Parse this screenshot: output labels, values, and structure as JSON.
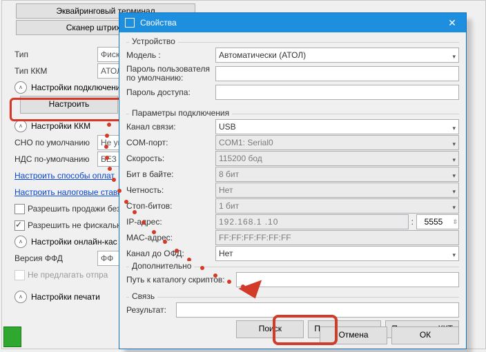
{
  "bg": {
    "top_buttons": [
      "Эквайринговый терминал",
      "Сканер штрих-кодов"
    ],
    "rows": {
      "tip_label": "Тип",
      "tip_value": "Фискал",
      "tipkkm_label": "Тип ККМ",
      "tipkkm_value": "АТОЛ",
      "sect_conn": "Настройки подключения",
      "nastr_btn": "Настроить",
      "sect_kkm": "Настройки ККМ",
      "sno_label": "СНО по умолчанию",
      "sno_value": "Не ук",
      "nds_label": "НДС по-умолчанию",
      "nds_value": "БЕЗ Н",
      "link_pay": "Настроить способы оплат",
      "link_tax": "Настроить налоговые ставки",
      "cb1": "Разрешить продажи без",
      "cb2": "Разрешить не фискальн",
      "sect_online": "Настройки онлайн-кас",
      "ffd_label": "Версия ФФД",
      "ffd_value": "ФФ",
      "cb_greyed": "Не предлагать отпра",
      "sect_print": "Настройки печати"
    }
  },
  "dlg": {
    "title": "Свойства",
    "group_device": "Устройство",
    "model_label": "Модель :",
    "model_value": "Автоматически (АТОЛ)",
    "userpwd_label": "Пароль пользователя по умолчанию:",
    "accesspwd_label": "Пароль доступа:",
    "group_conn": "Параметры подключения",
    "channel_label": "Канал связи:",
    "channel_value": "USB",
    "comport_label": "COM-порт:",
    "comport_value": "COM1: Serial0",
    "speed_label": "Скорость:",
    "speed_value": "115200 бод",
    "bits_label": "Бит в байте:",
    "bits_value": "8 бит",
    "parity_label": "Четность:",
    "parity_value": "Нет",
    "stopbits_label": "Стоп-битов:",
    "stopbits_value": "1 бит",
    "ip_label": "IP-адрес:",
    "ip_value": "192.168.1 .10",
    "port_value": "5555",
    "mac_label": "MAC-адрес:",
    "mac_value": "FF:FF:FF:FF:FF:FF",
    "ofd_label": "Канал до ОФД:",
    "ofd_value": "Нет",
    "group_extra": "Дополнительно",
    "scriptpath_label": "Путь к каталогу скриптов:",
    "group_link": "Связь",
    "result_label": "Результат:",
    "btn_search": "Поиск",
    "btn_check": "Проверка связи",
    "btn_params": "Параметры ККТ",
    "btn_cancel": "Отмена",
    "btn_ok": "ОК"
  }
}
